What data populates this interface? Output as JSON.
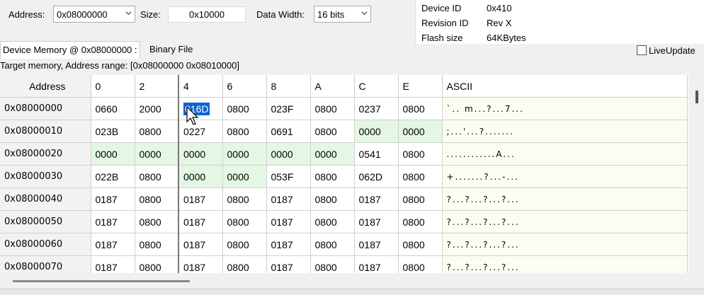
{
  "toolbar": {
    "address_label": "Address:",
    "address_value": "0x08000000",
    "size_label": "Size:",
    "size_value": "0x10000",
    "width_label": "Data Width:",
    "width_value": "16 bits"
  },
  "device_info": [
    {
      "label": "Device ID",
      "value": "0x410"
    },
    {
      "label": "Revision ID",
      "value": "Rev X"
    },
    {
      "label": "Flash size",
      "value": "64KBytes"
    }
  ],
  "tabs": {
    "memory": "Device Memory @ 0x08000000 :",
    "binary": "Binary File"
  },
  "live_update": "LiveUpdate",
  "range_text": "Target memory, Address range: [0x08000000 0x08010000]",
  "table": {
    "headers": [
      "Address",
      "0",
      "2",
      "4",
      "6",
      "8",
      "A",
      "C",
      "E",
      "ASCII"
    ],
    "rows": [
      {
        "addr": "0x08000000",
        "c": [
          "0660",
          "2000",
          "016D",
          "0800",
          "023F",
          "0800",
          "0237",
          "0800"
        ],
        "ascii": "`..  m...?...7..."
      },
      {
        "addr": "0x08000010",
        "c": [
          "023B",
          "0800",
          "0227",
          "0800",
          "0691",
          "0800",
          "0000",
          "0000"
        ],
        "ascii": ";...'...?......."
      },
      {
        "addr": "0x08000020",
        "c": [
          "0000",
          "0000",
          "0000",
          "0000",
          "0000",
          "0000",
          "0541",
          "0800"
        ],
        "ascii": "............A..."
      },
      {
        "addr": "0x08000030",
        "c": [
          "022B",
          "0800",
          "0000",
          "0000",
          "053F",
          "0800",
          "062D",
          "0800"
        ],
        "ascii": "+.......?...-..."
      },
      {
        "addr": "0x08000040",
        "c": [
          "0187",
          "0800",
          "0187",
          "0800",
          "0187",
          "0800",
          "0187",
          "0800"
        ],
        "ascii": "?...?...?...?..."
      },
      {
        "addr": "0x08000050",
        "c": [
          "0187",
          "0800",
          "0187",
          "0800",
          "0187",
          "0800",
          "0187",
          "0800"
        ],
        "ascii": "?...?...?...?..."
      },
      {
        "addr": "0x08000060",
        "c": [
          "0187",
          "0800",
          "0187",
          "0800",
          "0187",
          "0800",
          "0187",
          "0800"
        ],
        "ascii": "?...?...?...?..."
      },
      {
        "addr": "0x08000070",
        "c": [
          "0187",
          "0800",
          "0187",
          "0800",
          "0187",
          "0800",
          "0187",
          "0800"
        ],
        "ascii": "?...?...?...?..."
      }
    ]
  }
}
